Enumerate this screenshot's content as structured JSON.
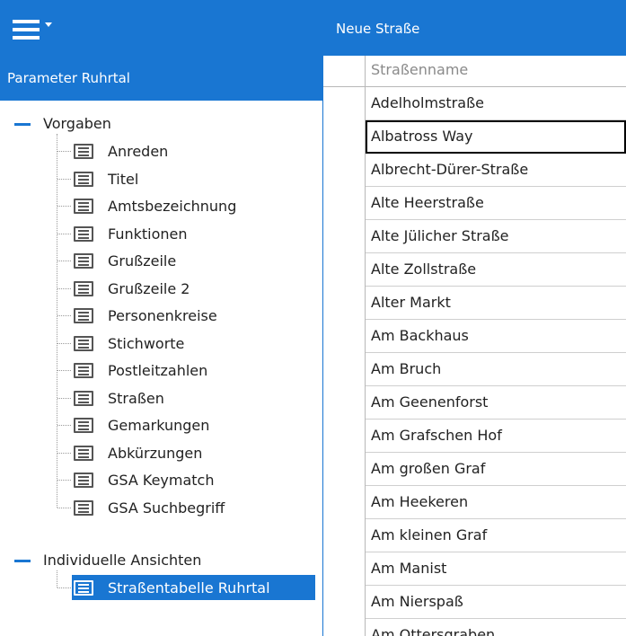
{
  "colors": {
    "accent": "#1976d2",
    "header_text": "#ffffff"
  },
  "header": {
    "title": "Neue Straße",
    "menu_icon": "hamburger-menu-icon"
  },
  "sidebar": {
    "title": "Parameter Ruhrtal",
    "groups": [
      {
        "label": "Vorgaben",
        "expanded": true,
        "items": [
          {
            "label": "Anreden"
          },
          {
            "label": "Titel"
          },
          {
            "label": "Amtsbezeichnung"
          },
          {
            "label": "Funktionen"
          },
          {
            "label": "Grußzeile"
          },
          {
            "label": "Grußzeile 2"
          },
          {
            "label": "Personenkreise"
          },
          {
            "label": "Stichworte"
          },
          {
            "label": "Postleitzahlen"
          },
          {
            "label": "Straßen"
          },
          {
            "label": "Gemarkungen"
          },
          {
            "label": "Abkürzungen"
          },
          {
            "label": "GSA Keymatch"
          },
          {
            "label": "GSA Suchbegriff"
          }
        ]
      },
      {
        "label": "Individuelle Ansichten",
        "expanded": true,
        "items": [
          {
            "label": "Straßentabelle Ruhrtal",
            "selected": true
          }
        ]
      }
    ]
  },
  "table": {
    "column_header": "Straßenname",
    "selected_row": 1,
    "rows": [
      "Adelholmstraße",
      "Albatross Way",
      "Albrecht-Dürer-Straße",
      "Alte Heerstraße",
      "Alte Jülicher Straße",
      "Alte Zollstraße",
      "Alter Markt",
      "Am Backhaus",
      "Am Bruch",
      "Am Geenenforst",
      "Am Grafschen Hof",
      "Am großen Graf",
      "Am Heekeren",
      "Am kleinen Graf",
      "Am Manist",
      "Am Nierspaß",
      "Am Ottersgraben"
    ]
  }
}
